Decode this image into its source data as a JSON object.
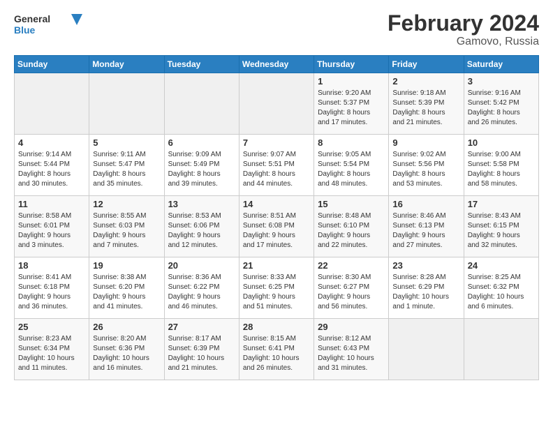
{
  "logo": {
    "line1": "General",
    "line2": "Blue"
  },
  "title": "February 2024",
  "location": "Gamovo, Russia",
  "weekdays": [
    "Sunday",
    "Monday",
    "Tuesday",
    "Wednesday",
    "Thursday",
    "Friday",
    "Saturday"
  ],
  "weeks": [
    [
      {
        "day": "",
        "info": ""
      },
      {
        "day": "",
        "info": ""
      },
      {
        "day": "",
        "info": ""
      },
      {
        "day": "",
        "info": ""
      },
      {
        "day": "1",
        "info": "Sunrise: 9:20 AM\nSunset: 5:37 PM\nDaylight: 8 hours\nand 17 minutes."
      },
      {
        "day": "2",
        "info": "Sunrise: 9:18 AM\nSunset: 5:39 PM\nDaylight: 8 hours\nand 21 minutes."
      },
      {
        "day": "3",
        "info": "Sunrise: 9:16 AM\nSunset: 5:42 PM\nDaylight: 8 hours\nand 26 minutes."
      }
    ],
    [
      {
        "day": "4",
        "info": "Sunrise: 9:14 AM\nSunset: 5:44 PM\nDaylight: 8 hours\nand 30 minutes."
      },
      {
        "day": "5",
        "info": "Sunrise: 9:11 AM\nSunset: 5:47 PM\nDaylight: 8 hours\nand 35 minutes."
      },
      {
        "day": "6",
        "info": "Sunrise: 9:09 AM\nSunset: 5:49 PM\nDaylight: 8 hours\nand 39 minutes."
      },
      {
        "day": "7",
        "info": "Sunrise: 9:07 AM\nSunset: 5:51 PM\nDaylight: 8 hours\nand 44 minutes."
      },
      {
        "day": "8",
        "info": "Sunrise: 9:05 AM\nSunset: 5:54 PM\nDaylight: 8 hours\nand 48 minutes."
      },
      {
        "day": "9",
        "info": "Sunrise: 9:02 AM\nSunset: 5:56 PM\nDaylight: 8 hours\nand 53 minutes."
      },
      {
        "day": "10",
        "info": "Sunrise: 9:00 AM\nSunset: 5:58 PM\nDaylight: 8 hours\nand 58 minutes."
      }
    ],
    [
      {
        "day": "11",
        "info": "Sunrise: 8:58 AM\nSunset: 6:01 PM\nDaylight: 9 hours\nand 3 minutes."
      },
      {
        "day": "12",
        "info": "Sunrise: 8:55 AM\nSunset: 6:03 PM\nDaylight: 9 hours\nand 7 minutes."
      },
      {
        "day": "13",
        "info": "Sunrise: 8:53 AM\nSunset: 6:06 PM\nDaylight: 9 hours\nand 12 minutes."
      },
      {
        "day": "14",
        "info": "Sunrise: 8:51 AM\nSunset: 6:08 PM\nDaylight: 9 hours\nand 17 minutes."
      },
      {
        "day": "15",
        "info": "Sunrise: 8:48 AM\nSunset: 6:10 PM\nDaylight: 9 hours\nand 22 minutes."
      },
      {
        "day": "16",
        "info": "Sunrise: 8:46 AM\nSunset: 6:13 PM\nDaylight: 9 hours\nand 27 minutes."
      },
      {
        "day": "17",
        "info": "Sunrise: 8:43 AM\nSunset: 6:15 PM\nDaylight: 9 hours\nand 32 minutes."
      }
    ],
    [
      {
        "day": "18",
        "info": "Sunrise: 8:41 AM\nSunset: 6:18 PM\nDaylight: 9 hours\nand 36 minutes."
      },
      {
        "day": "19",
        "info": "Sunrise: 8:38 AM\nSunset: 6:20 PM\nDaylight: 9 hours\nand 41 minutes."
      },
      {
        "day": "20",
        "info": "Sunrise: 8:36 AM\nSunset: 6:22 PM\nDaylight: 9 hours\nand 46 minutes."
      },
      {
        "day": "21",
        "info": "Sunrise: 8:33 AM\nSunset: 6:25 PM\nDaylight: 9 hours\nand 51 minutes."
      },
      {
        "day": "22",
        "info": "Sunrise: 8:30 AM\nSunset: 6:27 PM\nDaylight: 9 hours\nand 56 minutes."
      },
      {
        "day": "23",
        "info": "Sunrise: 8:28 AM\nSunset: 6:29 PM\nDaylight: 10 hours\nand 1 minute."
      },
      {
        "day": "24",
        "info": "Sunrise: 8:25 AM\nSunset: 6:32 PM\nDaylight: 10 hours\nand 6 minutes."
      }
    ],
    [
      {
        "day": "25",
        "info": "Sunrise: 8:23 AM\nSunset: 6:34 PM\nDaylight: 10 hours\nand 11 minutes."
      },
      {
        "day": "26",
        "info": "Sunrise: 8:20 AM\nSunset: 6:36 PM\nDaylight: 10 hours\nand 16 minutes."
      },
      {
        "day": "27",
        "info": "Sunrise: 8:17 AM\nSunset: 6:39 PM\nDaylight: 10 hours\nand 21 minutes."
      },
      {
        "day": "28",
        "info": "Sunrise: 8:15 AM\nSunset: 6:41 PM\nDaylight: 10 hours\nand 26 minutes."
      },
      {
        "day": "29",
        "info": "Sunrise: 8:12 AM\nSunset: 6:43 PM\nDaylight: 10 hours\nand 31 minutes."
      },
      {
        "day": "",
        "info": ""
      },
      {
        "day": "",
        "info": ""
      }
    ]
  ]
}
